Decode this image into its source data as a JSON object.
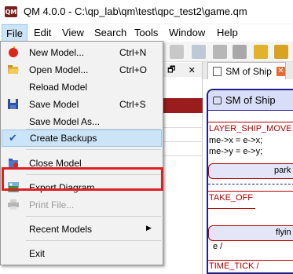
{
  "window": {
    "title": "QM 4.0.0 - C:\\qp_lab\\qm\\test\\qpc_test2\\game.qm",
    "icon_text": "QM"
  },
  "menubar": {
    "items": [
      "File",
      "Edit",
      "View",
      "Search",
      "Tools",
      "Window",
      "Help"
    ]
  },
  "file_menu": {
    "items": [
      {
        "label": "New Model...",
        "shortcut": "Ctrl+N",
        "icon": "new-model-icon"
      },
      {
        "label": "Open Model...",
        "shortcut": "Ctrl+O",
        "icon": "open-folder-icon"
      },
      {
        "label": "Reload Model",
        "shortcut": "",
        "icon": ""
      },
      {
        "label": "Save Model",
        "shortcut": "Ctrl+S",
        "icon": "save-disk-icon"
      },
      {
        "label": "Save Model As...",
        "shortcut": "",
        "icon": ""
      },
      {
        "label": "Create Backups",
        "shortcut": "",
        "icon": "checkmark-icon",
        "checked": true
      },
      {
        "label": "Close Model",
        "shortcut": "",
        "icon": "close-model-icon"
      },
      {
        "label": "Export Diagram...",
        "shortcut": "",
        "icon": "export-diagram-icon"
      },
      {
        "label": "Print File...",
        "shortcut": "",
        "icon": "printer-icon",
        "disabled": true
      },
      {
        "label": "Recent Models",
        "shortcut": "",
        "icon": "",
        "submenu": true
      },
      {
        "label": "Exit",
        "shortcut": "",
        "icon": ""
      }
    ],
    "submenu_arrow": "▶"
  },
  "document": {
    "tab_label": "SM of Ship",
    "tab_close": "✕",
    "sm_title": "SM of Ship",
    "texts": {
      "player_ship_move": "LAYER_SHIP_MOVE",
      "me_x": "me->x = e->x;",
      "me_y": "me->y = e->y;",
      "park": "park",
      "take_off": "TAKE_OFF",
      "flying": "flyin",
      "e_slash": "e /",
      "time_tick": "TIME_TICK /"
    }
  },
  "panel": {
    "header_glyph": "🗗",
    "header_close": "✕"
  },
  "colors": {
    "highlight": "#e02020",
    "selection": "#cce4f7",
    "transition_red": "#b00000",
    "sm_border": "#1f1f8a"
  }
}
